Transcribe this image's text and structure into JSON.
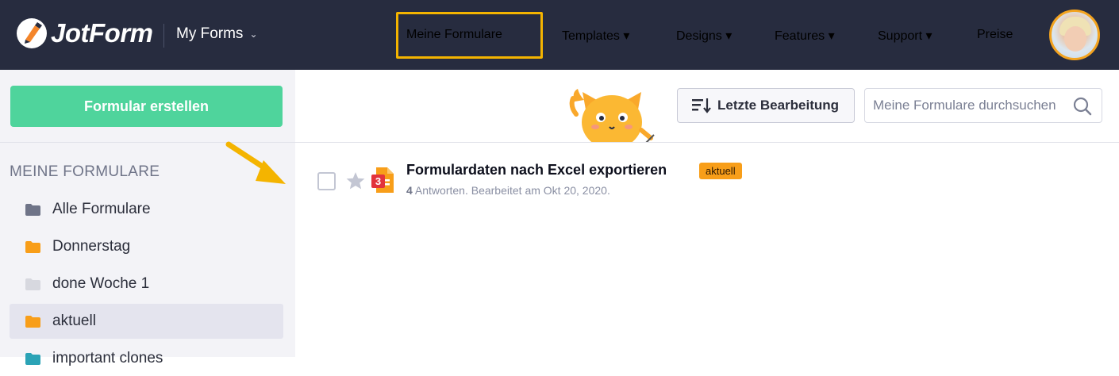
{
  "header": {
    "brand": "JotForm",
    "forms_menu": "My Forms",
    "nav": [
      "Meine Formulare",
      "Templates ▾",
      "Designs ▾",
      "Features ▾",
      "Support ▾",
      "Preise"
    ],
    "highlighted_nav_index": 0,
    "highlight_color": "#f4b400"
  },
  "sidebar": {
    "create_button": "Formular erstellen",
    "heading": "MEINE FORMULARE",
    "folders": [
      {
        "label": "Alle Formulare",
        "color": "#6f7488"
      },
      {
        "label": "Donnerstag",
        "color": "#f89e19"
      },
      {
        "label": "done Woche 1",
        "color": "#d7d8df"
      },
      {
        "label": "aktuell",
        "color": "#f89e19",
        "active": true
      },
      {
        "label": "important clones",
        "color": "#2ba3b6"
      }
    ]
  },
  "toolbar": {
    "sort_label": "Letzte Bearbeitung",
    "search_placeholder": "Meine Formulare durchsuchen"
  },
  "forms": [
    {
      "title": "Formulardaten nach Excel exportieren",
      "badge": "aktuell",
      "responses": "4",
      "meta": " Antworten. Bearbeitet am Okt 20, 2020.",
      "notification_count": "3"
    }
  ],
  "colors": {
    "topbar": "#272c3f",
    "create_button": "#4fd49c",
    "badge": "#f89e19",
    "annotation_arrow": "#f4b400"
  }
}
